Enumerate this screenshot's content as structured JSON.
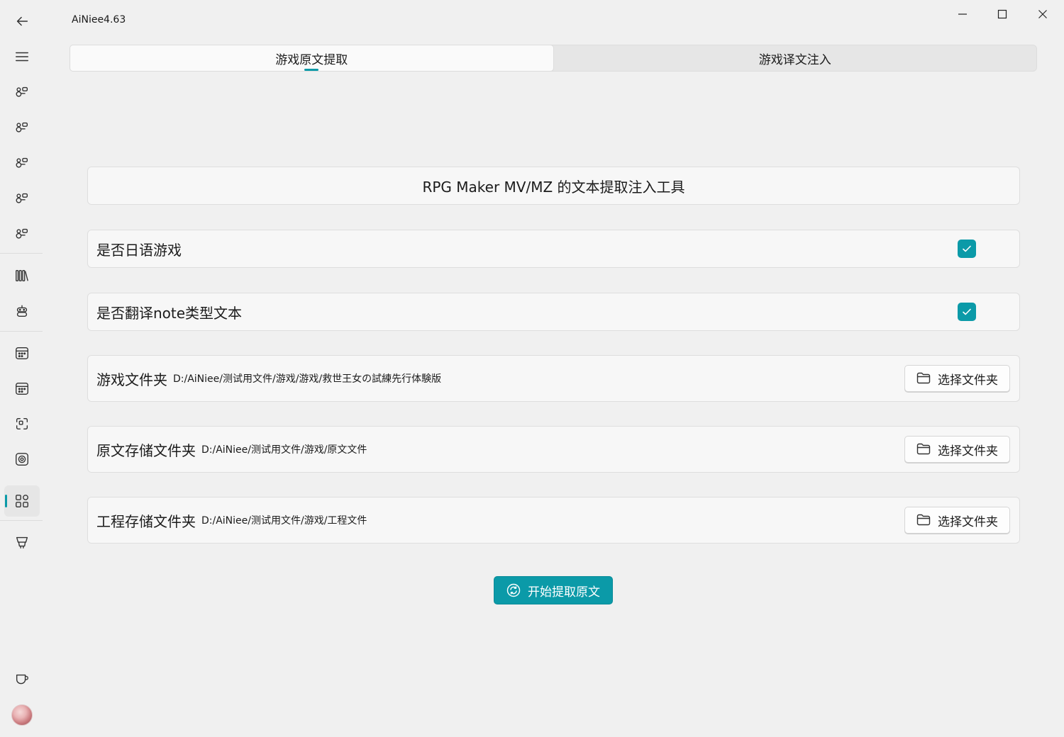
{
  "app": {
    "title": "AiNiee4.63"
  },
  "tabs": [
    {
      "label": "游戏原文提取",
      "active": true
    },
    {
      "label": "游戏译文注入",
      "active": false
    }
  ],
  "main": {
    "tool_title": "RPG Maker MV/MZ 的文本提取注入工具",
    "options": [
      {
        "label": "是否日语游戏",
        "checked": true
      },
      {
        "label": "是否翻译note类型文本",
        "checked": true
      }
    ],
    "folders": [
      {
        "label": "游戏文件夹",
        "path": "D:/AiNiee/测试用文件/游戏/游戏/救世王女の試練先行体験版",
        "button": "选择文件夹"
      },
      {
        "label": "原文存储文件夹",
        "path": "D:/AiNiee/测试用文件/游戏/原文文件",
        "button": "选择文件夹"
      },
      {
        "label": "工程存储文件夹",
        "path": "D:/AiNiee/测试用文件/游戏/工程文件",
        "button": "选择文件夹"
      }
    ],
    "start_button": "开始提取原文"
  },
  "colors": {
    "accent": "#0b9aa8",
    "background": "#f0f0f0",
    "card": "#f7f7f7"
  },
  "sidebar_icons": [
    "back-icon",
    "menu-icon",
    "api-icon",
    "api-icon",
    "api-icon",
    "api-icon",
    "api-icon",
    "library-icon",
    "robot-icon",
    "calendar-icon",
    "calendar-icon",
    "scan-icon",
    "target-icon",
    "apps-icon",
    "plugin-icon",
    "coffee-icon",
    "avatar"
  ]
}
